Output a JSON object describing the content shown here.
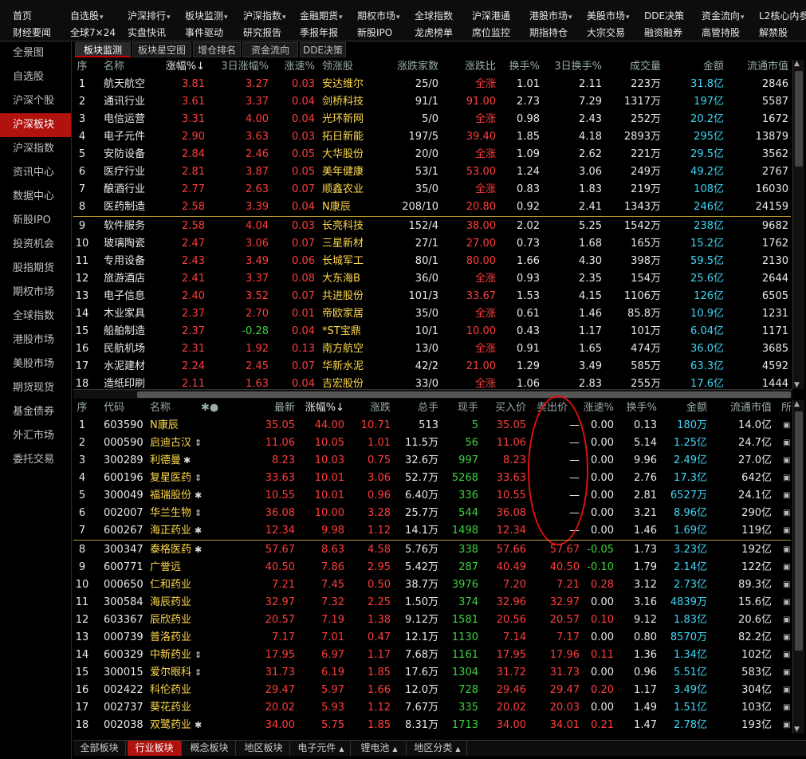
{
  "menu_row1": [
    {
      "label": "首页",
      "dd": false
    },
    {
      "label": "自选股",
      "dd": true
    },
    {
      "label": "沪深排行",
      "dd": true
    },
    {
      "label": "板块监测",
      "dd": true
    },
    {
      "label": "沪深指数",
      "dd": true
    },
    {
      "label": "金融期货",
      "dd": true
    },
    {
      "label": "期权市场",
      "dd": true
    },
    {
      "label": "全球指数",
      "dd": false
    },
    {
      "label": "沪深港通",
      "dd": false
    },
    {
      "label": "港股市场",
      "dd": true
    },
    {
      "label": "美股市场",
      "dd": true
    },
    {
      "label": "DDE决策",
      "dd": false
    },
    {
      "label": "资金流向",
      "dd": true
    },
    {
      "label": "L2核心内参",
      "dd": false
    }
  ],
  "menu_row2": [
    "财经要闻",
    "全球7×24",
    "实盘快讯",
    "事件驱动",
    "研究报告",
    "季报年报",
    "新股IPO",
    "龙虎榜单",
    "席位监控",
    "期指持仓",
    "大宗交易",
    "融资融券",
    "高管持股",
    "解禁股"
  ],
  "sidebar": [
    "全景图",
    "自选股",
    "沪深个股",
    "沪深板块",
    "沪深指数",
    "资讯中心",
    "数据中心",
    "新股IPO",
    "投资机会",
    "股指期货",
    "期权市场",
    "全球指数",
    "港股市场",
    "美股市场",
    "期货现货",
    "基金债券",
    "外汇市场",
    "委托交易"
  ],
  "sidebar_active": 3,
  "main_tabs": [
    "板块监测",
    "板块星空图",
    "增仓排名",
    "资金流向",
    "DDE决策"
  ],
  "top_headers": [
    "序",
    "名称",
    "涨幅%↓",
    "3日涨幅%",
    "涨速%",
    "领涨股",
    "涨跌家数",
    "涨跌比",
    "换手%",
    "3日换手%",
    "成交量",
    "金额",
    "流通市值"
  ],
  "top_rows": [
    {
      "n": "1",
      "name": "航天航空",
      "chg": "3.81",
      "chg3": "3.27",
      "spd": "0.03",
      "lead": "安达维尔",
      "cnt": "25/0",
      "ratio": "全涨",
      "to": "1.01",
      "to3": "2.11",
      "vol": "223万",
      "amt": "31.8亿",
      "mcap": "2846"
    },
    {
      "n": "2",
      "name": "通讯行业",
      "chg": "3.61",
      "chg3": "3.37",
      "spd": "0.04",
      "lead": "剑桥科技",
      "cnt": "91/1",
      "ratio": "91.00",
      "to": "2.73",
      "to3": "7.29",
      "vol": "1317万",
      "amt": "197亿",
      "mcap": "5587"
    },
    {
      "n": "3",
      "name": "电信运营",
      "chg": "3.31",
      "chg3": "4.00",
      "spd": "0.04",
      "lead": "光环新网",
      "cnt": "5/0",
      "ratio": "全涨",
      "to": "0.98",
      "to3": "2.43",
      "vol": "252万",
      "amt": "20.2亿",
      "mcap": "1672"
    },
    {
      "n": "4",
      "name": "电子元件",
      "chg": "2.90",
      "chg3": "3.63",
      "spd": "0.03",
      "lead": "拓日新能",
      "cnt": "197/5",
      "ratio": "39.40",
      "to": "1.85",
      "to3": "4.18",
      "vol": "2893万",
      "amt": "295亿",
      "mcap": "13879"
    },
    {
      "n": "5",
      "name": "安防设备",
      "chg": "2.84",
      "chg3": "2.46",
      "spd": "0.05",
      "lead": "大华股份",
      "cnt": "20/0",
      "ratio": "全涨",
      "to": "1.09",
      "to3": "2.62",
      "vol": "221万",
      "amt": "29.5亿",
      "mcap": "3562"
    },
    {
      "n": "6",
      "name": "医疗行业",
      "chg": "2.81",
      "chg3": "3.87",
      "spd": "0.05",
      "lead": "美年健康",
      "cnt": "53/1",
      "ratio": "53.00",
      "to": "1.24",
      "to3": "3.06",
      "vol": "249万",
      "amt": "49.2亿",
      "mcap": "2767"
    },
    {
      "n": "7",
      "name": "酿酒行业",
      "chg": "2.77",
      "chg3": "2.63",
      "spd": "0.07",
      "lead": "顺鑫农业",
      "cnt": "35/0",
      "ratio": "全涨",
      "to": "0.83",
      "to3": "1.83",
      "vol": "219万",
      "amt": "108亿",
      "mcap": "16030"
    },
    {
      "n": "8",
      "name": "医药制造",
      "chg": "2.58",
      "chg3": "3.39",
      "spd": "0.04",
      "lead": "N康辰",
      "cnt": "208/10",
      "ratio": "20.80",
      "to": "0.92",
      "to3": "2.41",
      "vol": "1343万",
      "amt": "246亿",
      "mcap": "24159"
    },
    {
      "n": "9",
      "name": "软件服务",
      "chg": "2.58",
      "chg3": "4.04",
      "spd": "0.03",
      "lead": "长亮科技",
      "cnt": "152/4",
      "ratio": "38.00",
      "to": "2.02",
      "to3": "5.25",
      "vol": "1542万",
      "amt": "238亿",
      "mcap": "9682"
    },
    {
      "n": "10",
      "name": "玻璃陶瓷",
      "chg": "2.47",
      "chg3": "3.06",
      "spd": "0.07",
      "lead": "三星新材",
      "cnt": "27/1",
      "ratio": "27.00",
      "to": "0.73",
      "to3": "1.68",
      "vol": "165万",
      "amt": "15.2亿",
      "mcap": "1762"
    },
    {
      "n": "11",
      "name": "专用设备",
      "chg": "2.43",
      "chg3": "3.49",
      "spd": "0.06",
      "lead": "长城军工",
      "cnt": "80/1",
      "ratio": "80.00",
      "to": "1.66",
      "to3": "4.30",
      "vol": "398万",
      "amt": "59.5亿",
      "mcap": "2130"
    },
    {
      "n": "12",
      "name": "旅游酒店",
      "chg": "2.41",
      "chg3": "3.37",
      "spd": "0.08",
      "lead": "大东海B",
      "cnt": "36/0",
      "ratio": "全涨",
      "to": "0.93",
      "to3": "2.35",
      "vol": "154万",
      "amt": "25.6亿",
      "mcap": "2644"
    },
    {
      "n": "13",
      "name": "电子信息",
      "chg": "2.40",
      "chg3": "3.52",
      "spd": "0.07",
      "lead": "共进股份",
      "cnt": "101/3",
      "ratio": "33.67",
      "to": "1.53",
      "to3": "4.15",
      "vol": "1106万",
      "amt": "126亿",
      "mcap": "6505"
    },
    {
      "n": "14",
      "name": "木业家具",
      "chg": "2.37",
      "chg3": "2.70",
      "spd": "0.01",
      "lead": "帝欧家居",
      "cnt": "35/0",
      "ratio": "全涨",
      "to": "0.61",
      "to3": "1.46",
      "vol": "85.8万",
      "amt": "10.9亿",
      "mcap": "1231"
    },
    {
      "n": "15",
      "name": "船舶制造",
      "chg": "2.37",
      "chg3": "-0.28",
      "spd": "0.04",
      "lead": "*ST宝鼎",
      "cnt": "10/1",
      "ratio": "10.00",
      "to": "0.43",
      "to3": "1.17",
      "vol": "101万",
      "amt": "6.04亿",
      "mcap": "1171"
    },
    {
      "n": "16",
      "name": "民航机场",
      "chg": "2.31",
      "chg3": "1.92",
      "spd": "0.13",
      "lead": "南方航空",
      "cnt": "13/0",
      "ratio": "全涨",
      "to": "0.91",
      "to3": "1.65",
      "vol": "474万",
      "amt": "36.0亿",
      "mcap": "3685"
    },
    {
      "n": "17",
      "name": "水泥建材",
      "chg": "2.24",
      "chg3": "2.45",
      "spd": "0.07",
      "lead": "华新水泥",
      "cnt": "42/2",
      "ratio": "21.00",
      "to": "1.29",
      "to3": "3.49",
      "vol": "585万",
      "amt": "63.3亿",
      "mcap": "4592"
    },
    {
      "n": "18",
      "name": "造纸印刷",
      "chg": "2.11",
      "chg3": "1.63",
      "spd": "0.04",
      "lead": "吉宏股份",
      "cnt": "33/0",
      "ratio": "全涨",
      "to": "1.06",
      "to3": "2.83",
      "vol": "255万",
      "amt": "17.6亿",
      "mcap": "1444"
    }
  ],
  "bottom_headers": [
    "序",
    "代码",
    "名称",
    "✱●",
    "最新",
    "涨幅%↓",
    "涨跌",
    "总手",
    "现手",
    "买入价",
    "卖出价",
    "涨速%",
    "换手%",
    "金额",
    "流通市值",
    "所"
  ],
  "bottom_rows": [
    {
      "n": "1",
      "code": "603590",
      "name": "N康辰",
      "sym": "",
      "last": "35.05",
      "chg": "44.00",
      "diff": "10.71",
      "tot": "513",
      "cur": "5",
      "bid": "35.05",
      "ask": "—",
      "spd": "0.00",
      "to": "0.13",
      "amt": "180万",
      "mcap": "14.0亿"
    },
    {
      "n": "2",
      "code": "000590",
      "name": "启迪古汉",
      "sym": "⇕",
      "last": "11.06",
      "chg": "10.05",
      "diff": "1.01",
      "tot": "11.5万",
      "cur": "56",
      "bid": "11.06",
      "ask": "—",
      "spd": "0.00",
      "to": "5.14",
      "amt": "1.25亿",
      "mcap": "24.7亿"
    },
    {
      "n": "3",
      "code": "300289",
      "name": "利德曼",
      "sym": "✱",
      "last": "8.23",
      "chg": "10.03",
      "diff": "0.75",
      "tot": "32.6万",
      "cur": "997",
      "bid": "8.23",
      "ask": "—",
      "spd": "0.00",
      "to": "9.96",
      "amt": "2.49亿",
      "mcap": "27.0亿"
    },
    {
      "n": "4",
      "code": "600196",
      "name": "复星医药",
      "sym": "⇕",
      "last": "33.63",
      "chg": "10.01",
      "diff": "3.06",
      "tot": "52.7万",
      "cur": "5268",
      "bid": "33.63",
      "ask": "—",
      "spd": "0.00",
      "to": "2.76",
      "amt": "17.3亿",
      "mcap": "642亿"
    },
    {
      "n": "5",
      "code": "300049",
      "name": "福瑞股份",
      "sym": "✱",
      "last": "10.55",
      "chg": "10.01",
      "diff": "0.96",
      "tot": "6.40万",
      "cur": "336",
      "bid": "10.55",
      "ask": "—",
      "spd": "0.00",
      "to": "2.81",
      "amt": "6527万",
      "mcap": "24.1亿"
    },
    {
      "n": "6",
      "code": "002007",
      "name": "华兰生物",
      "sym": "⇕",
      "last": "36.08",
      "chg": "10.00",
      "diff": "3.28",
      "tot": "25.7万",
      "cur": "544",
      "bid": "36.08",
      "ask": "—",
      "spd": "0.00",
      "to": "3.21",
      "amt": "8.96亿",
      "mcap": "290亿"
    },
    {
      "n": "7",
      "code": "600267",
      "name": "海正药业",
      "sym": "✱",
      "last": "12.34",
      "chg": "9.98",
      "diff": "1.12",
      "tot": "14.1万",
      "cur": "1498",
      "bid": "12.34",
      "ask": "—",
      "spd": "0.00",
      "to": "1.46",
      "amt": "1.69亿",
      "mcap": "119亿"
    },
    {
      "n": "8",
      "code": "300347",
      "name": "泰格医药",
      "sym": "✱",
      "last": "57.67",
      "chg": "8.63",
      "diff": "4.58",
      "tot": "5.76万",
      "cur": "338",
      "bid": "57.66",
      "ask": "57.67",
      "spd": "-0.05",
      "to": "1.73",
      "amt": "3.23亿",
      "mcap": "192亿"
    },
    {
      "n": "9",
      "code": "600771",
      "name": "广誉远",
      "sym": "",
      "last": "40.50",
      "chg": "7.86",
      "diff": "2.95",
      "tot": "5.42万",
      "cur": "287",
      "bid": "40.49",
      "ask": "40.50",
      "spd": "-0.10",
      "to": "1.79",
      "amt": "2.14亿",
      "mcap": "122亿"
    },
    {
      "n": "10",
      "code": "000650",
      "name": "仁和药业",
      "sym": "",
      "last": "7.21",
      "chg": "7.45",
      "diff": "0.50",
      "tot": "38.7万",
      "cur": "3976",
      "bid": "7.20",
      "ask": "7.21",
      "spd": "0.28",
      "to": "3.12",
      "amt": "2.73亿",
      "mcap": "89.3亿"
    },
    {
      "n": "11",
      "code": "300584",
      "name": "海辰药业",
      "sym": "",
      "last": "32.97",
      "chg": "7.32",
      "diff": "2.25",
      "tot": "1.50万",
      "cur": "374",
      "bid": "32.96",
      "ask": "32.97",
      "spd": "0.00",
      "to": "3.16",
      "amt": "4839万",
      "mcap": "15.6亿"
    },
    {
      "n": "12",
      "code": "603367",
      "name": "辰欣药业",
      "sym": "",
      "last": "20.57",
      "chg": "7.19",
      "diff": "1.38",
      "tot": "9.12万",
      "cur": "1581",
      "bid": "20.56",
      "ask": "20.57",
      "spd": "0.10",
      "to": "9.12",
      "amt": "1.83亿",
      "mcap": "20.6亿"
    },
    {
      "n": "13",
      "code": "000739",
      "name": "普洛药业",
      "sym": "",
      "last": "7.17",
      "chg": "7.01",
      "diff": "0.47",
      "tot": "12.1万",
      "cur": "1130",
      "bid": "7.14",
      "ask": "7.17",
      "spd": "0.00",
      "to": "0.80",
      "amt": "8570万",
      "mcap": "82.2亿"
    },
    {
      "n": "14",
      "code": "600329",
      "name": "中新药业",
      "sym": "⇕",
      "last": "17.95",
      "chg": "6.97",
      "diff": "1.17",
      "tot": "7.68万",
      "cur": "1161",
      "bid": "17.95",
      "ask": "17.96",
      "spd": "0.11",
      "to": "1.36",
      "amt": "1.34亿",
      "mcap": "102亿"
    },
    {
      "n": "15",
      "code": "300015",
      "name": "爱尔眼科",
      "sym": "⇕",
      "last": "31.73",
      "chg": "6.19",
      "diff": "1.85",
      "tot": "17.6万",
      "cur": "1304",
      "bid": "31.72",
      "ask": "31.73",
      "spd": "0.00",
      "to": "0.96",
      "amt": "5.51亿",
      "mcap": "583亿"
    },
    {
      "n": "16",
      "code": "002422",
      "name": "科伦药业",
      "sym": "",
      "last": "29.47",
      "chg": "5.97",
      "diff": "1.66",
      "tot": "12.0万",
      "cur": "728",
      "bid": "29.46",
      "ask": "29.47",
      "spd": "0.20",
      "to": "1.17",
      "amt": "3.49亿",
      "mcap": "304亿"
    },
    {
      "n": "17",
      "code": "002737",
      "name": "葵花药业",
      "sym": "",
      "last": "20.02",
      "chg": "5.93",
      "diff": "1.12",
      "tot": "7.67万",
      "cur": "335",
      "bid": "20.02",
      "ask": "20.03",
      "spd": "0.00",
      "to": "1.49",
      "amt": "1.51亿",
      "mcap": "103亿"
    },
    {
      "n": "18",
      "code": "002038",
      "name": "双鹭药业",
      "sym": "✱",
      "last": "34.00",
      "chg": "5.75",
      "diff": "1.85",
      "tot": "8.31万",
      "cur": "1713",
      "bid": "34.00",
      "ask": "34.01",
      "spd": "0.21",
      "to": "1.47",
      "amt": "2.78亿",
      "mcap": "193亿"
    }
  ],
  "bottom_tabs": [
    {
      "label": "全部板块",
      "dd": false
    },
    {
      "label": "行业板块",
      "dd": false
    },
    {
      "label": "概念板块",
      "dd": false
    },
    {
      "label": "地区板块",
      "dd": false
    },
    {
      "label": "电子元件",
      "dd": true
    },
    {
      "label": "锂电池",
      "dd": true
    },
    {
      "label": "地区分类",
      "dd": true
    }
  ],
  "bottom_tab_active": 1,
  "colors": {
    "up": "#ff3c3c",
    "down": "#3cd13c",
    "amount": "#3fd6f5",
    "active": "#b0120e"
  }
}
